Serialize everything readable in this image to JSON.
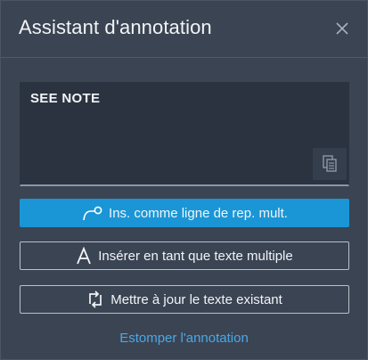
{
  "dialog": {
    "title": "Assistant d'annotation",
    "close_icon": "close-icon"
  },
  "text_box": {
    "value": "SEE NOTE",
    "paste_icon": "paste-icon"
  },
  "buttons": {
    "insert_mleader": {
      "label": "Ins. comme ligne de rep. mult.",
      "icon": "multileader-icon"
    },
    "insert_mtext": {
      "label": "Insérer en tant que texte multiple",
      "icon": "text-a-icon"
    },
    "update_text": {
      "label": "Mettre à jour le texte existant",
      "icon": "update-icon"
    }
  },
  "link": {
    "label": "Estomper l'annotation"
  },
  "colors": {
    "background": "#3b4453",
    "text_area": "#2b3340",
    "accent": "#1a96d6",
    "link": "#4aa8e6",
    "text": "#f2f4f7"
  }
}
